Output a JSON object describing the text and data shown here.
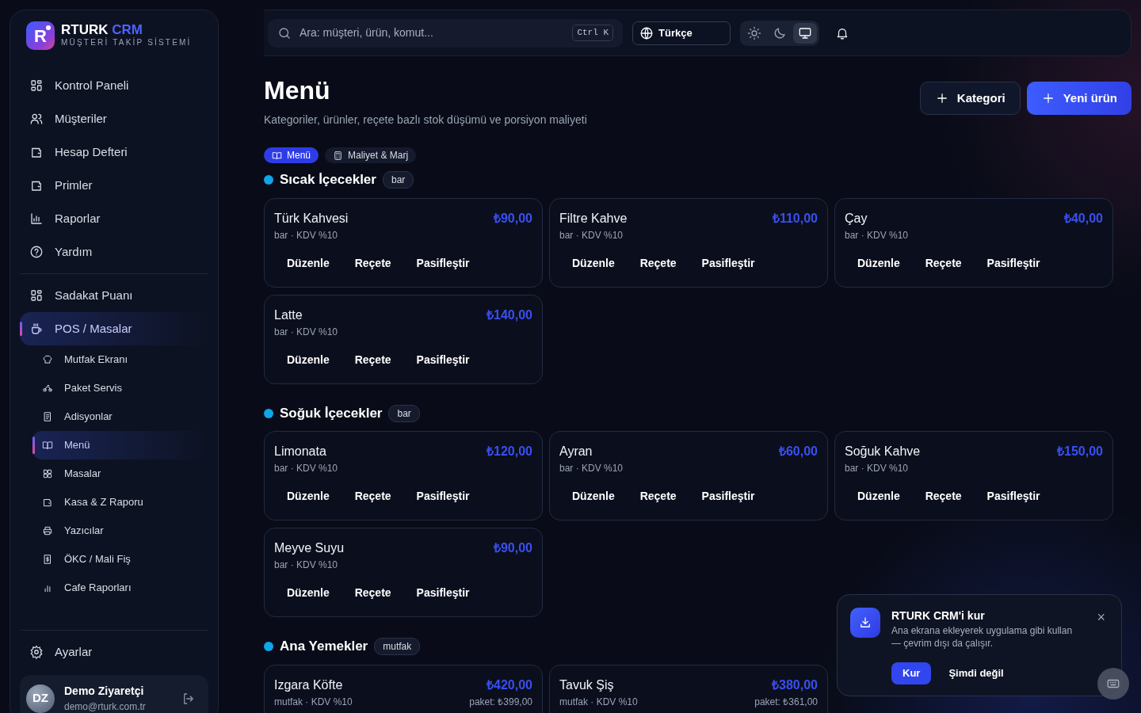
{
  "brand": {
    "logo_letter": "R",
    "name": "RTURK",
    "name_accent": "CRM",
    "subtitle": "MÜŞTERİ TAKİP SİSTEMİ"
  },
  "sidebar": {
    "items": [
      {
        "label": "Kontrol Paneli",
        "selected": false
      },
      {
        "label": "Müşteriler",
        "selected": false
      },
      {
        "label": "Hesap Defteri",
        "selected": false
      },
      {
        "label": "Primler",
        "selected": false
      },
      {
        "label": "Raporlar",
        "selected": false
      },
      {
        "label": "Yardım",
        "selected": false
      }
    ],
    "items_2": [
      {
        "label": "Sadakat Puanı",
        "selected": false
      },
      {
        "label": "POS / Masalar",
        "selected": true,
        "children": [
          {
            "label": "Mutfak Ekranı",
            "selected": false
          },
          {
            "label": "Paket Servis",
            "selected": false
          },
          {
            "label": "Adisyonlar",
            "selected": false
          },
          {
            "label": "Menü",
            "selected": true
          },
          {
            "label": "Masalar",
            "selected": false
          },
          {
            "label": "Kasa & Z Raporu",
            "selected": false
          },
          {
            "label": "Yazıcılar",
            "selected": false
          },
          {
            "label": "ÖKC / Mali Fiş",
            "selected": false
          },
          {
            "label": "Cafe Raporları",
            "selected": false
          }
        ]
      }
    ],
    "settings": "Ayarlar",
    "user": {
      "initials": "DZ",
      "name": "Demo Ziyaretçi",
      "email": "demo@rturk.com.tr"
    }
  },
  "topbar": {
    "search": {
      "placeholder": "Ara: müşteri, ürün, komut...",
      "shortcut": "Ctrl K"
    },
    "language": "Türkçe",
    "theme_modes": [
      {
        "selected": false
      },
      {
        "selected": false
      },
      {
        "selected": true
      }
    ]
  },
  "page": {
    "title": "Menü",
    "subtitle": "Kategoriler, ürünler, reçete bazlı stok düşümü ve porsiyon maliyeti",
    "buttons": [
      {
        "label": "Kategori",
        "primary": false
      },
      {
        "label": "Yeni ürün",
        "primary": true
      }
    ],
    "tabs": [
      {
        "label": "Menü",
        "selected": true
      },
      {
        "label": "Maliyet & Marj",
        "selected": false
      }
    ]
  },
  "categories": [
    {
      "name": "Sıcak İçecekler",
      "station": "bar",
      "color": "#0ea5e9",
      "products": [
        {
          "name": "Türk Kahvesi",
          "price": "₺90,00",
          "meta": "bar · KDV %10",
          "actions": [
            "Düzenle",
            "Reçete",
            "Pasifleştir"
          ]
        },
        {
          "name": "Filtre Kahve",
          "price": "₺110,00",
          "meta": "bar · KDV %10",
          "actions": [
            "Düzenle",
            "Reçete",
            "Pasifleştir"
          ]
        },
        {
          "name": "Çay",
          "price": "₺40,00",
          "meta": "bar · KDV %10",
          "actions": [
            "Düzenle",
            "Reçete",
            "Pasifleştir"
          ]
        },
        {
          "name": "Latte",
          "price": "₺140,00",
          "meta": "bar · KDV %10",
          "actions": [
            "Düzenle",
            "Reçete",
            "Pasifleştir"
          ]
        }
      ]
    },
    {
      "name": "Soğuk İçecekler",
      "station": "bar",
      "color": "#0ea5e9",
      "products": [
        {
          "name": "Limonata",
          "price": "₺120,00",
          "meta": "bar · KDV %10",
          "actions": [
            "Düzenle",
            "Reçete",
            "Pasifleştir"
          ]
        },
        {
          "name": "Ayran",
          "price": "₺60,00",
          "meta": "bar · KDV %10",
          "actions": [
            "Düzenle",
            "Reçete",
            "Pasifleştir"
          ]
        },
        {
          "name": "Soğuk Kahve",
          "price": "₺150,00",
          "meta": "bar · KDV %10",
          "actions": [
            "Düzenle",
            "Reçete",
            "Pasifleştir"
          ]
        },
        {
          "name": "Meyve Suyu",
          "price": "₺90,00",
          "meta": "bar · KDV %10",
          "actions": [
            "Düzenle",
            "Reçete",
            "Pasifleştir"
          ]
        }
      ]
    },
    {
      "name": "Ana Yemekler",
      "station": "mutfak",
      "color": "#0ea5e9",
      "products": [
        {
          "name": "Izgara Köfte",
          "price": "₺420,00",
          "meta": "mutfak · KDV %10",
          "package_price": "paket: ₺399,00"
        },
        {
          "name": "Tavuk Şiş",
          "price": "₺380,00",
          "meta": "mutfak · KDV %10",
          "package_price": "paket: ₺361,00"
        }
      ]
    }
  ],
  "install_prompt": {
    "title": "RTURK CRM'i kur",
    "text": "Ana ekrana ekleyerek uygulama gibi kullan — çevrim dışı da çalışır.",
    "close": "×",
    "buttons": [
      {
        "label": "Kur",
        "primary": true
      },
      {
        "label": "Şimdi değil",
        "primary": false
      }
    ]
  }
}
